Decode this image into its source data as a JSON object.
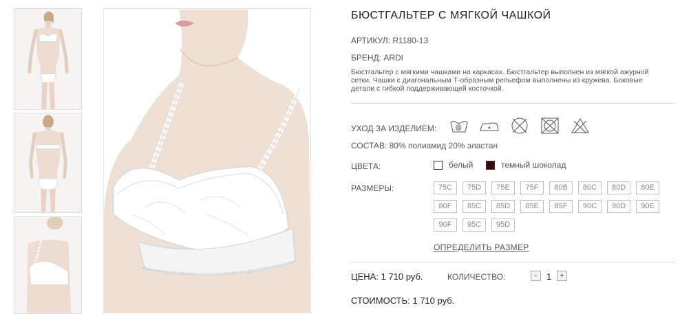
{
  "product": {
    "title": "БЮСТГАЛЬТЕР С МЯГКОЙ ЧАШКОЙ",
    "article": "АРТИКУЛ: R1180-13",
    "brand": "БРЕНД: ARDI",
    "description": "Бюстгальтер с мягкими чашками на каркасах. Бюстгальтер выполнен из мягкой ажурной сетки. Чашки с диагональным Т-образным рельефом выполнены из кружева. Боковые детали с гибкой поддерживающей косточкой."
  },
  "care": {
    "label": "УХОД ЗА ИЗДЕЛИЕМ:",
    "icons": [
      "hand-wash-icon",
      "iron-low-icon",
      "no-dry-clean-icon",
      "no-tumble-dry-icon",
      "no-bleach-icon"
    ]
  },
  "composition": "СОСТАВ: 80% полиамид 20% эластан",
  "colors": {
    "label": "ЦВЕТА:",
    "options": [
      {
        "name": "белый",
        "hex": "#ffffff"
      },
      {
        "name": "темный шоколад",
        "hex": "#3b0a0a"
      }
    ]
  },
  "sizes": {
    "label": "РАЗМЕРЫ:",
    "items": [
      "75C",
      "75D",
      "75E",
      "75F",
      "80B",
      "80C",
      "80D",
      "80E",
      "80F",
      "85C",
      "85D",
      "85E",
      "85F",
      "90C",
      "90D",
      "90E",
      "90F",
      "95C",
      "95D"
    ],
    "size_guide_link": "ОПРЕДЕЛИТЬ РАЗМЕР"
  },
  "order": {
    "price": "ЦЕНА: 1 710 руб.",
    "quantity_label": "КОЛИЧЕСТВО:",
    "minus": "-",
    "quantity": "1",
    "plus": "+",
    "total": "СТОИМОСТЬ: 1 710 руб."
  }
}
